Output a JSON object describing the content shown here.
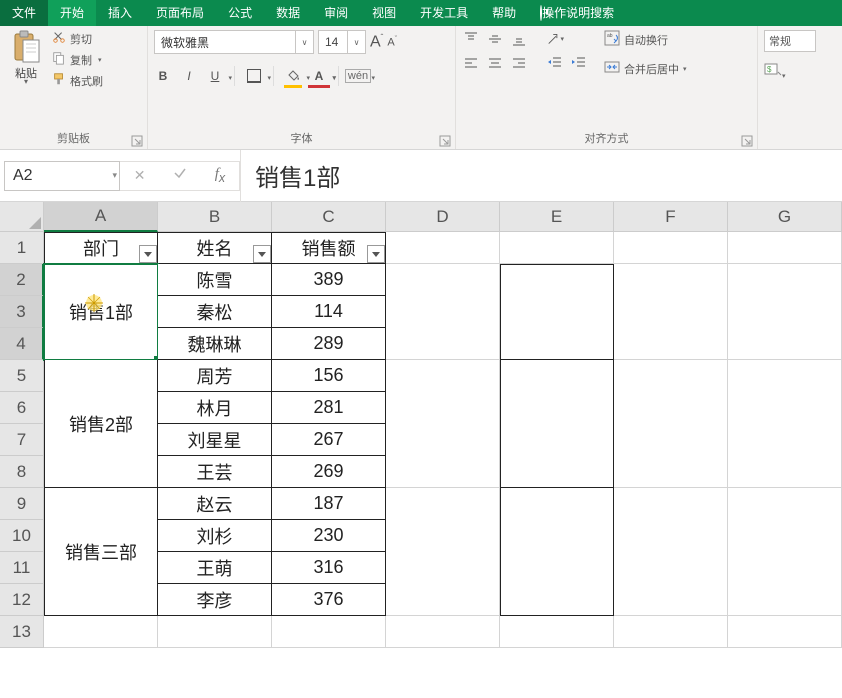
{
  "tabs": {
    "file": "文件",
    "home": "开始",
    "insert": "插入",
    "layout": "页面布局",
    "formulas": "公式",
    "data": "数据",
    "review": "审阅",
    "view": "视图",
    "dev": "开发工具",
    "help": "帮助",
    "tellme": "操作说明搜索"
  },
  "ribbon": {
    "clipboard": {
      "paste": "粘贴",
      "cut": "剪切",
      "copy": "复制",
      "painter": "格式刷",
      "label": "剪贴板"
    },
    "font": {
      "name": "微软雅黑",
      "size": "14",
      "label": "字体",
      "phonetic": "wén"
    },
    "align": {
      "wrap": "自动换行",
      "merge": "合并后居中",
      "label": "对齐方式"
    },
    "number": {
      "format": "常规"
    }
  },
  "namebox": "A2",
  "formula": "销售1部",
  "cols": [
    "A",
    "B",
    "C",
    "D",
    "E",
    "F",
    "G"
  ],
  "rows": [
    "1",
    "2",
    "3",
    "4",
    "5",
    "6",
    "7",
    "8",
    "9",
    "10",
    "11",
    "12",
    "13"
  ],
  "headers": {
    "dept": "部门",
    "name": "姓名",
    "sales": "销售额"
  },
  "dept": {
    "d1": "销售1部",
    "d2": "销售2部",
    "d3": "销售三部"
  },
  "people": {
    "r2": {
      "n": "陈雪",
      "v": "389"
    },
    "r3": {
      "n": "秦松",
      "v": "114"
    },
    "r4": {
      "n": "魏琳琳",
      "v": "289"
    },
    "r5": {
      "n": "周芳",
      "v": "156"
    },
    "r6": {
      "n": "林月",
      "v": "281"
    },
    "r7": {
      "n": "刘星星",
      "v": "267"
    },
    "r8": {
      "n": "王芸",
      "v": "269"
    },
    "r9": {
      "n": "赵云",
      "v": "187"
    },
    "r10": {
      "n": "刘杉",
      "v": "230"
    },
    "r11": {
      "n": "王萌",
      "v": "316"
    },
    "r12": {
      "n": "李彦",
      "v": "376"
    }
  }
}
